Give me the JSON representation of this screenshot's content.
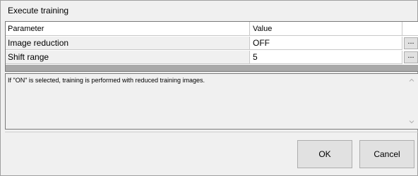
{
  "dialog": {
    "title": "Execute training"
  },
  "grid": {
    "columns": {
      "parameter": "Parameter",
      "value": "Value"
    },
    "rows": [
      {
        "parameter": "Image reduction",
        "value": "OFF",
        "button": "..."
      },
      {
        "parameter": "Shift range",
        "value": "5",
        "button": "..."
      }
    ]
  },
  "description": {
    "text": "If \"ON\" is selected, training is performed with reduced training images."
  },
  "buttons": {
    "ok": "OK",
    "cancel": "Cancel"
  }
}
